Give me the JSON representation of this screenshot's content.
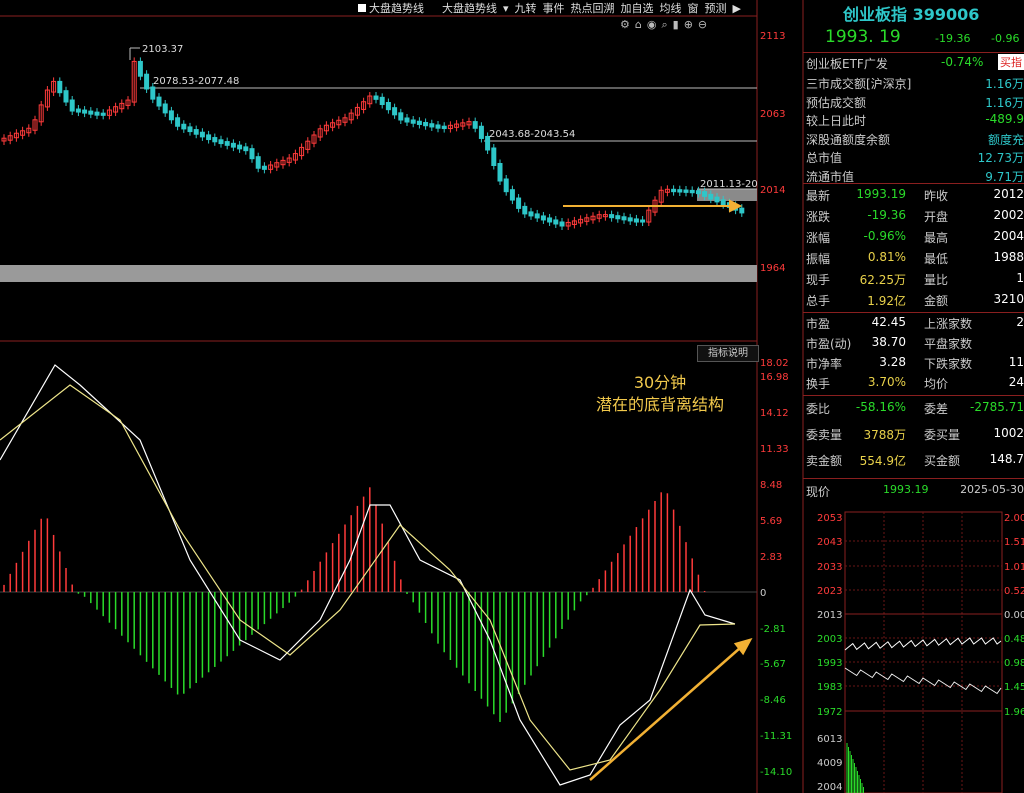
{
  "toolbar": {
    "items": [
      "大盘趋势线",
      "大盘趋势线",
      "九转",
      "事件",
      "热点回溯",
      "加自选",
      "均线",
      "窗",
      "预测"
    ],
    "icons": [
      "gear-icon",
      "lock-icon",
      "eye-icon",
      "magnify-icon",
      "bar-icon",
      "plus-icon",
      "minus-icon"
    ]
  },
  "kline": {
    "price_labels": [
      "2113",
      "2063",
      "2014",
      "1964"
    ],
    "annotations": {
      "high": "2103.37",
      "level1": "2078.53-2077.48",
      "level2": "2043.68-2043.54",
      "level3": "2011.13-20"
    }
  },
  "macd": {
    "button": "指标说明",
    "labels": [
      "18.02",
      "16.98",
      "14.12",
      "11.33",
      "8.48",
      "5.69",
      "2.83",
      "0",
      "-2.81",
      "-5.67",
      "-8.46",
      "-11.31",
      "-14.10"
    ],
    "annotation_line1": "30分钟",
    "annotation_line2": "潜在的底背离结构"
  },
  "quote": {
    "name": "创业板指",
    "code": "399006",
    "price": "1993. 19",
    "change": "-19.36",
    "change_pct": "-0.96",
    "etf_name": "创业板ETF广发",
    "etf_pct": "-0.74%",
    "etf_btn": "买指",
    "rows_a": [
      {
        "label": "三市成交额[沪深京]",
        "value": "1.16万"
      },
      {
        "label": "预估成交额",
        "value": "1.16万"
      },
      {
        "label": "较上日此时",
        "value": "-489.9"
      },
      {
        "label": "深股通额度余额",
        "value": "额度充"
      },
      {
        "label": "总市值",
        "value": "12.73万"
      },
      {
        "label": "流通市值",
        "value": "9.71万"
      }
    ],
    "rows_b": [
      {
        "l": "最新",
        "v": "1993.19",
        "l2": "昨收",
        "v2": "2012"
      },
      {
        "l": "涨跌",
        "v": "-19.36",
        "l2": "开盘",
        "v2": "2002"
      },
      {
        "l": "涨幅",
        "v": "-0.96%",
        "l2": "最高",
        "v2": "2004"
      },
      {
        "l": "振幅",
        "v": "0.81%",
        "l2": "最低",
        "v2": "1988"
      },
      {
        "l": "现手",
        "v": "62.25万",
        "l2": "量比",
        "v2": "1"
      },
      {
        "l": "总手",
        "v": "1.92亿",
        "l2": "金额",
        "v2": "3210"
      }
    ],
    "rows_c": [
      {
        "l": "市盈",
        "v": "42.45",
        "l2": "上涨家数",
        "v2": "2"
      },
      {
        "l": "市盈(动)",
        "v": "38.70",
        "l2": "平盘家数",
        "v2": ""
      },
      {
        "l": "市净率",
        "v": "3.28",
        "l2": "下跌家数",
        "v2": "11"
      },
      {
        "l": "换手",
        "v": "3.70%",
        "l2": "均价",
        "v2": "24"
      }
    ],
    "rows_d": [
      {
        "l": "委比",
        "v": "-58.16%",
        "l2": "委差",
        "v2": "-2785.71"
      },
      {
        "l": "委卖量",
        "v": "3788万",
        "l2": "委买量",
        "v2": "1002"
      },
      {
        "l": "卖金额",
        "v": "554.9亿",
        "l2": "买金额",
        "v2": "148.7"
      }
    ],
    "now_label": "现价",
    "now_value": "1993.19",
    "date": "2025-05-30"
  },
  "mini": {
    "left_labels": [
      "2053",
      "2043",
      "2033",
      "2023",
      "2013",
      "2003",
      "1993",
      "1983",
      "1972",
      "6013",
      "4009",
      "2004"
    ],
    "right_labels": [
      "2.00",
      "1.51",
      "1.01",
      "0.52",
      "0.00",
      "0.48",
      "0.98",
      "1.45",
      "1.96"
    ]
  },
  "colors": {
    "up": "#ff3b3b",
    "down": "#2ec7c9",
    "macd_down": "#2adb2a",
    "arrow": "#f2b134"
  }
}
